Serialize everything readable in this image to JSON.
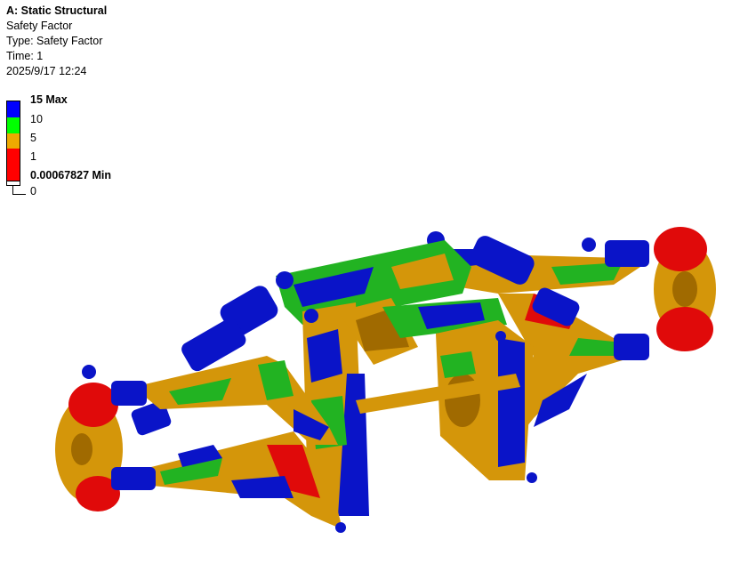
{
  "analysis": {
    "title": "A: Static Structural",
    "result": "Safety Factor",
    "type": "Type: Safety Factor",
    "time": "Time: 1",
    "timestamp": "2025/9/17 12:24"
  },
  "legend": {
    "max_label": "15 Max",
    "ticks": [
      "10",
      "5",
      "1"
    ],
    "min_label": "0.00067827 Min",
    "zero_label": "0",
    "colors": [
      "#0000ff",
      "#00ff00",
      "#eeaa00",
      "#ff0000",
      "#ffffff"
    ]
  },
  "model": {
    "name": "suspension-assembly",
    "colors": {
      "blue": "#0a14c8",
      "green": "#22b322",
      "orange": "#d4960a",
      "red": "#e00a0a",
      "dark_orange": "#a06a00"
    }
  }
}
